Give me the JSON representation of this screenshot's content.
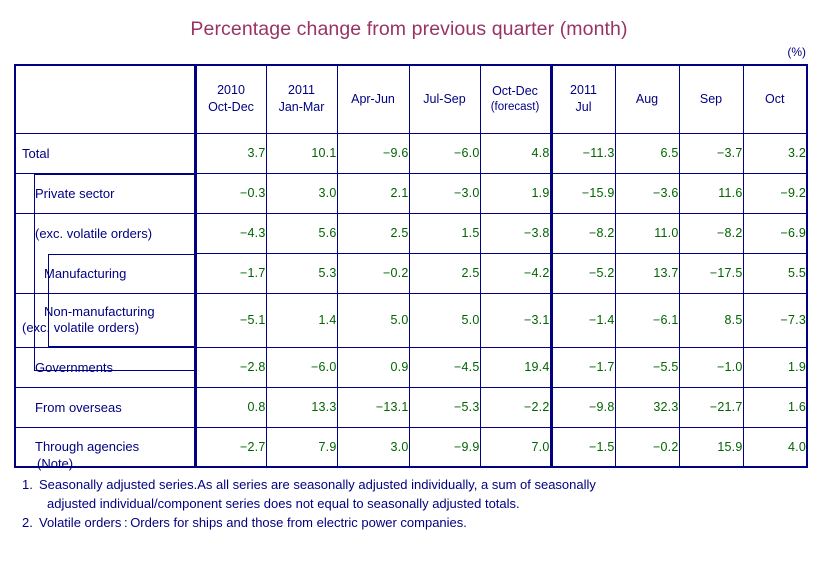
{
  "title": "Percentage change from previous quarter (month)",
  "unit": "(%)",
  "table": {
    "header": {
      "blank": "",
      "columns": [
        {
          "year": "2010",
          "period": "Oct-Dec",
          "note": ""
        },
        {
          "year": "2011",
          "period": "Jan-Mar",
          "note": ""
        },
        {
          "year": "",
          "period": "Apr-Jun",
          "note": ""
        },
        {
          "year": "",
          "period": "Jul-Sep",
          "note": ""
        },
        {
          "year": "",
          "period": "Oct-Dec",
          "note": "(forecast)"
        },
        {
          "year": "2011",
          "period": "Jul",
          "note": ""
        },
        {
          "year": "",
          "period": "Aug",
          "note": ""
        },
        {
          "year": "",
          "period": "Sep",
          "note": ""
        },
        {
          "year": "",
          "period": "Oct",
          "note": ""
        }
      ]
    },
    "rows": [
      {
        "label": "Total",
        "label2": "",
        "indent": 0,
        "values": [
          "3.7",
          "10.1",
          "−9.6",
          "−6.0",
          "4.8",
          "−11.3",
          "6.5",
          "−3.7",
          "3.2"
        ]
      },
      {
        "label": "Private sector",
        "label2": "",
        "indent": 1,
        "values": [
          "−0.3",
          "3.0",
          "2.1",
          "−3.0",
          "1.9",
          "−15.9",
          "−3.6",
          "11.6",
          "−9.2"
        ]
      },
      {
        "label": "(exc. volatile orders)",
        "label2": "",
        "indent": 1,
        "values": [
          "−4.3",
          "5.6",
          "2.5",
          "1.5",
          "−3.8",
          "−8.2",
          "11.0",
          "−8.2",
          "−6.9"
        ]
      },
      {
        "label": "Manufacturing",
        "label2": "",
        "indent": 2,
        "values": [
          "−1.7",
          "5.3",
          "−0.2",
          "2.5",
          "−4.2",
          "−5.2",
          "13.7",
          "−17.5",
          "5.5"
        ]
      },
      {
        "label": "Non-manufacturing",
        "label2": "(exc. volatile orders)",
        "indent": 2,
        "values": [
          "−5.1",
          "1.4",
          "5.0",
          "5.0",
          "−3.1",
          "−1.4",
          "−6.1",
          "8.5",
          "−7.3"
        ]
      },
      {
        "label": "Governments",
        "label2": "",
        "indent": 1,
        "values": [
          "−2.8",
          "−6.0",
          "0.9",
          "−4.5",
          "19.4",
          "−1.7",
          "−5.5",
          "−1.0",
          "1.9"
        ]
      },
      {
        "label": "From overseas",
        "label2": "",
        "indent": 1,
        "values": [
          "0.8",
          "13.3",
          "−13.1",
          "−5.3",
          "−2.2",
          "−9.8",
          "32.3",
          "−21.7",
          "1.6"
        ]
      },
      {
        "label": "Through agencies",
        "label2": "",
        "indent": 1,
        "values": [
          "−2.7",
          "7.9",
          "3.0",
          "−9.9",
          "7.0",
          "−1.5",
          "−0.2",
          "15.9",
          "4.0"
        ]
      }
    ]
  },
  "notes": {
    "heading": "(Note)",
    "items": [
      {
        "number": "1.",
        "line1": "Seasonally adjusted series.As all series are seasonally adjusted individually,  a sum of seasonally",
        "line2": "adjusted individual/component series does not equal to seasonally adjusted totals."
      },
      {
        "number": "2.",
        "line1": "Volatile orders : Orders for ships and those from electric power companies.",
        "line2": ""
      }
    ]
  },
  "colors": {
    "title": "#993366",
    "border": "#000080",
    "label_text": "#000080",
    "value_text": "#006400"
  }
}
